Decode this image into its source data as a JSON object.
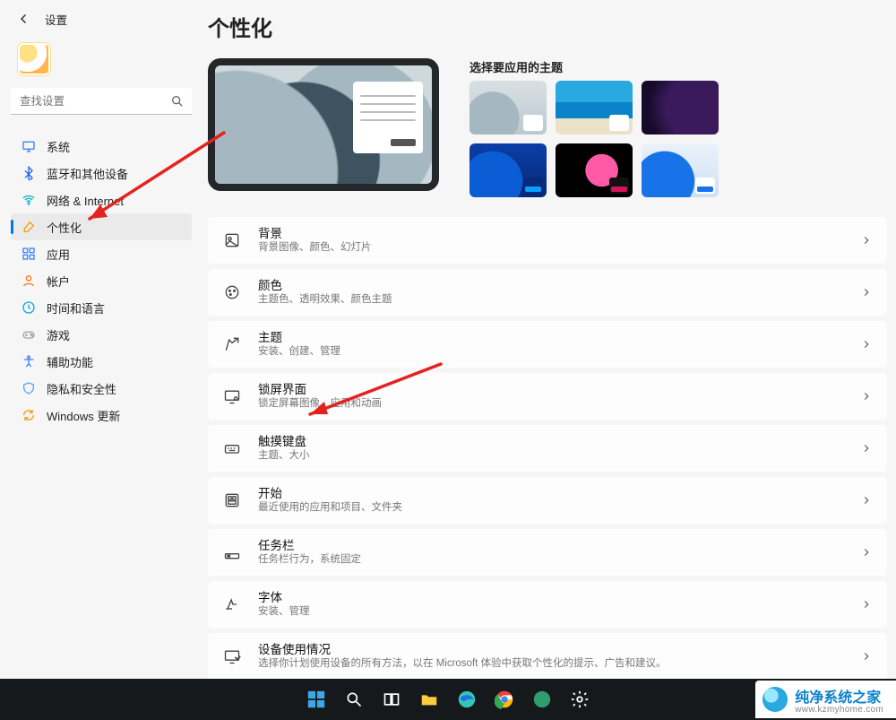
{
  "header": {
    "title": "设置"
  },
  "search": {
    "placeholder": "查找设置"
  },
  "nav": {
    "items": [
      {
        "label": "系统",
        "ico": "monitor",
        "color": "#3b82f6"
      },
      {
        "label": "蓝牙和其他设备",
        "ico": "bluetooth",
        "color": "#2563eb"
      },
      {
        "label": "网络 & Internet",
        "ico": "wifi",
        "color": "#06b6d4"
      },
      {
        "label": "个性化",
        "ico": "brush",
        "color": "#f59e0b",
        "selected": true
      },
      {
        "label": "应用",
        "ico": "apps",
        "color": "#3b82f6"
      },
      {
        "label": "帐户",
        "ico": "person",
        "color": "#f97316"
      },
      {
        "label": "时间和语言",
        "ico": "time",
        "color": "#0ea5e9"
      },
      {
        "label": "游戏",
        "ico": "game",
        "color": "#a3a3a3"
      },
      {
        "label": "辅助功能",
        "ico": "access",
        "color": "#3b82f6"
      },
      {
        "label": "隐私和安全性",
        "ico": "shield",
        "color": "#60a5fa"
      },
      {
        "label": "Windows 更新",
        "ico": "update",
        "color": "#f59e0b"
      }
    ]
  },
  "page": {
    "title": "个性化",
    "themes_title": "选择要应用的主题"
  },
  "cards": [
    {
      "title": "背景",
      "sub": "背景图像、颜色、幻灯片"
    },
    {
      "title": "颜色",
      "sub": "主题色、透明效果、颜色主题"
    },
    {
      "title": "主题",
      "sub": "安装、创建、管理"
    },
    {
      "title": "锁屏界面",
      "sub": "锁定屏幕图像、应用和动画"
    },
    {
      "title": "触摸键盘",
      "sub": "主题、大小"
    },
    {
      "title": "开始",
      "sub": "最近使用的应用和项目、文件夹"
    },
    {
      "title": "任务栏",
      "sub": "任务栏行为，系统固定"
    },
    {
      "title": "字体",
      "sub": "安装、管理"
    },
    {
      "title": "设备使用情况",
      "sub": "选择你计划使用设备的所有方法，以在 Microsoft 体验中获取个性化的提示、广告和建议。"
    }
  ],
  "brand": {
    "name": "纯净系统之家",
    "url": "www.kzmyhome.com"
  }
}
